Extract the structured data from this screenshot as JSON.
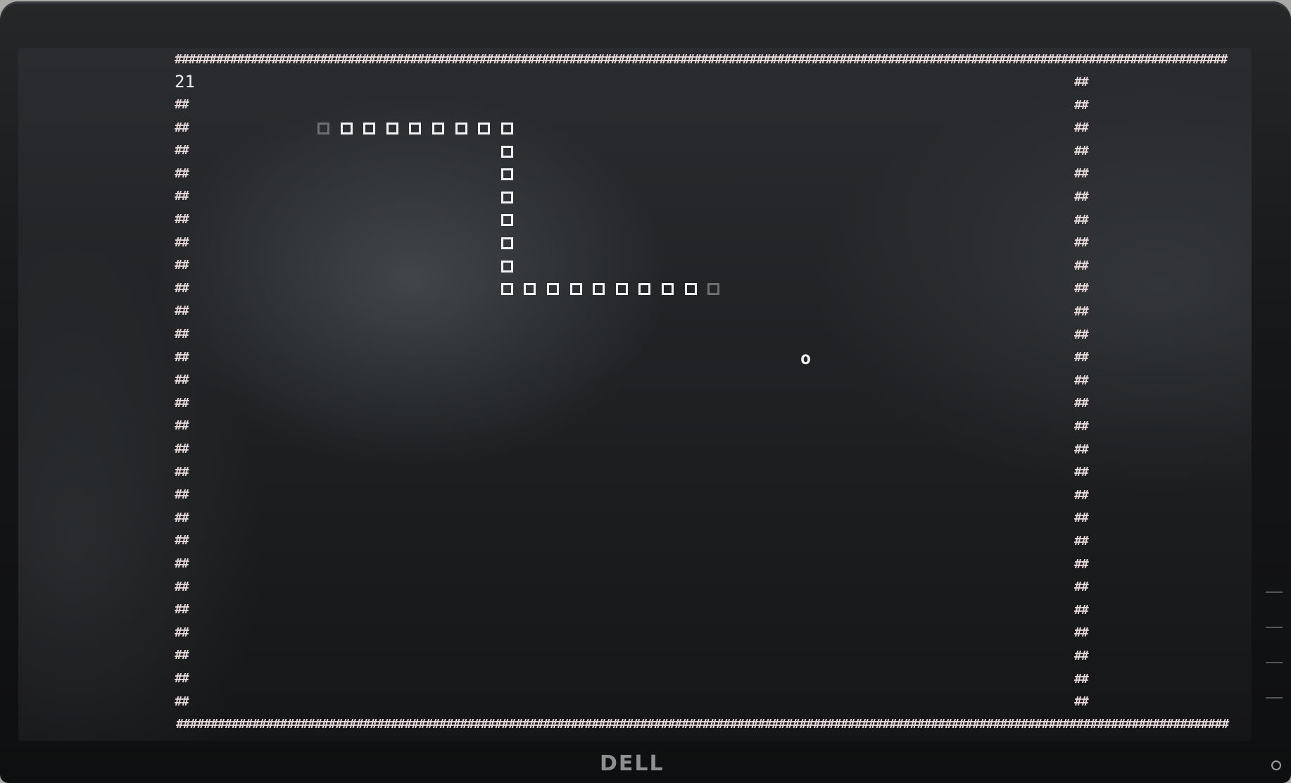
{
  "game": {
    "score": "21",
    "wall_glyph": "##",
    "snake_glyph": "□",
    "food_glyph": "o",
    "wall_color": "#e7d8d9",
    "snake_color": "#f2f2f2"
  },
  "monitor": {
    "brand": "DELL"
  }
}
